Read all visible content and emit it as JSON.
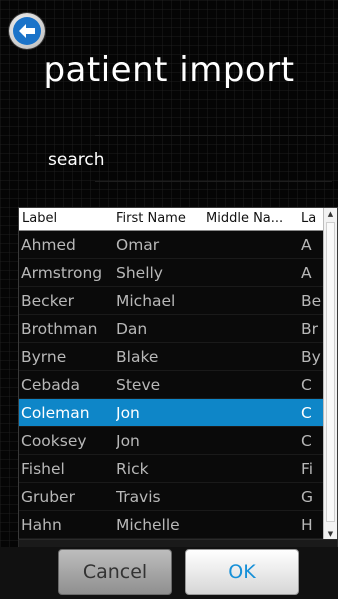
{
  "header": {
    "title": "patient import",
    "back_icon": "back-arrow-icon"
  },
  "search": {
    "label": "search",
    "value": "",
    "placeholder": ""
  },
  "table": {
    "columns": [
      "Label",
      "First Name",
      "Middle Na...",
      "La"
    ],
    "rows": [
      {
        "label": "Ahmed",
        "first": "Omar",
        "middle": "",
        "last": "A"
      },
      {
        "label": "Armstrong",
        "first": "Shelly",
        "middle": "",
        "last": "A"
      },
      {
        "label": "Becker",
        "first": "Michael",
        "middle": "",
        "last": "Be"
      },
      {
        "label": "Brothman",
        "first": "Dan",
        "middle": "",
        "last": "Br"
      },
      {
        "label": "Byrne",
        "first": "Blake",
        "middle": "",
        "last": "By"
      },
      {
        "label": "Cebada",
        "first": "Steve",
        "middle": "",
        "last": "C"
      },
      {
        "label": "Coleman",
        "first": "Jon",
        "middle": "",
        "last": "C"
      },
      {
        "label": "Cooksey",
        "first": "Jon",
        "middle": "",
        "last": "C"
      },
      {
        "label": "Fishel",
        "first": "Rick",
        "middle": "",
        "last": "Fi"
      },
      {
        "label": "Gruber",
        "first": "Travis",
        "middle": "",
        "last": "G"
      },
      {
        "label": "Hahn",
        "first": "Michelle",
        "middle": "",
        "last": "H"
      }
    ],
    "selected_index": 6,
    "selection_color": "#0e86c8"
  },
  "footer": {
    "cancel_label": "Cancel",
    "ok_label": "OK",
    "ok_color": "#1690d8"
  }
}
